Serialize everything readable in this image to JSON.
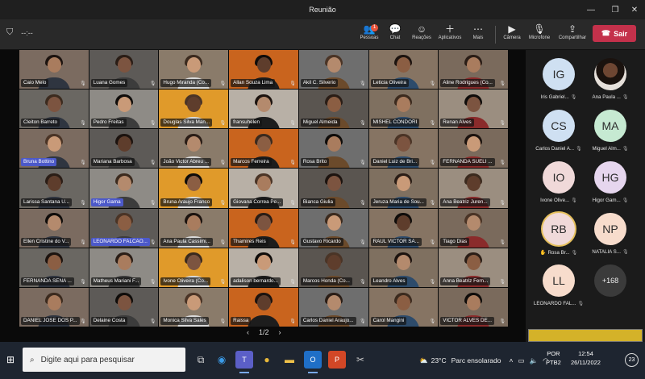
{
  "window": {
    "title": "Reunião"
  },
  "toolbar": {
    "timer": "--:--",
    "people_label": "Pessoas",
    "people_badge": "1",
    "chat_label": "Chat",
    "reactions_label": "Reações",
    "apps_label": "Aplicativos",
    "more_label": "Mais",
    "camera_label": "Câmera",
    "mic_label": "Microfone",
    "share_label": "Compartilhar",
    "leave_label": "Sair"
  },
  "tiles": [
    "Caio Melo",
    "Luana Gomes",
    "Hugo Miranda (Co...",
    "Allan Souza Lima",
    "Akil C. Silverio",
    "Leticia Oliveira",
    "Aline Rodrigues (Co...",
    "Cleiton Barreto",
    "Pedro Freitas",
    "Douglas Silva Man...",
    "fransuhelen",
    "Miguel Almeida",
    "MISHEL CONDORI",
    "Renan Alves",
    "Bruna Bottino",
    "Mariana Barbosa",
    "João Victor Abreu ...",
    "Marcos Ferreira",
    "Rosa Brito",
    "Daniel Luiz de Bri...",
    "FERNANDA SUELI ...",
    "Larissa Santana U...",
    "Higor Gama",
    "Bruna Araujo Franco",
    "Giovana Correa Pe...",
    "Bianca Giulia",
    "Jeruza Maria de Sou...",
    "Ana Beatriz Juren...",
    "Ellen Cristine do V...",
    "LEONARDO FALCAO...",
    "Ana Paula Cassimi...",
    "Thamires Reis",
    "Gustavo Ricardo",
    "RAUL VICTOR SA...",
    "Tiago Dias",
    "FERNANDA SENA ...",
    "Matheus Mariani F...",
    "Ivone Oliveira (Co...",
    "adalison bernardo...",
    "Marcos Honda (Co...",
    "Leandro Alves",
    "Anna Beatriz Fern...",
    "DANIEL JOSE DOS P...",
    "Delaine Costa",
    "Monica Silva Sales",
    "Raissa",
    "Carlos Daniel Araujo...",
    "Carol Mangini",
    "VICTOR ALVES DE..."
  ],
  "pager": {
    "label": "1/2",
    "prev": "‹",
    "next": "›"
  },
  "roster": [
    {
      "initials": "IG",
      "name": "Iris Gabriel..."
    },
    {
      "initials": "",
      "name": "Ana Paula ..."
    },
    {
      "initials": "CS",
      "name": "Carlos Daniel A..."
    },
    {
      "initials": "MA",
      "name": "Miguel Alm..."
    },
    {
      "initials": "IO",
      "name": "Ivone Olive..."
    },
    {
      "initials": "HG",
      "name": "Higor Gam..."
    },
    {
      "initials": "RB",
      "name": "Rosa Br..."
    },
    {
      "initials": "NP",
      "name": "NATALIA S..."
    },
    {
      "initials": "LL",
      "name": "LEONARDO FAL..."
    },
    {
      "initials": "+168",
      "name": ""
    }
  ],
  "taskbar": {
    "search_placeholder": "Digite aqui para pesquisar",
    "weather_temp": "23°C",
    "weather_text": "Parc ensolarado",
    "lang_1": "POR",
    "lang_2": "PTB2",
    "time": "12:54",
    "date": "26/11/2022",
    "notif_count": "23"
  }
}
